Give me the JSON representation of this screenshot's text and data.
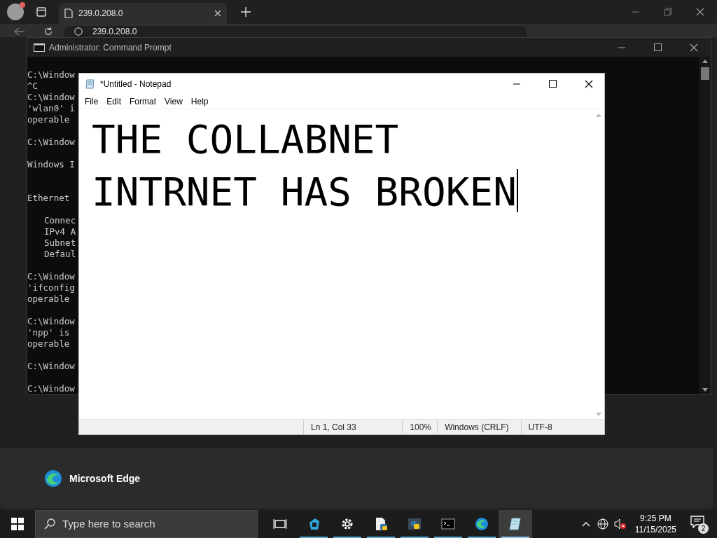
{
  "browser": {
    "tab_title": "239.0.208.0",
    "address": "239.0.208.0"
  },
  "cmd": {
    "title": "Administrator: Command Prompt",
    "lines": [
      {
        "kind": "line",
        "text": "C:\\Window"
      },
      {
        "kind": "line",
        "text": "^C"
      },
      {
        "kind": "line",
        "text": "C:\\Window"
      },
      {
        "kind": "line",
        "text": "'wlan0' i"
      },
      {
        "kind": "line",
        "text": "operable"
      },
      {
        "kind": "blank"
      },
      {
        "kind": "line",
        "text": "C:\\Window"
      },
      {
        "kind": "blank"
      },
      {
        "kind": "line",
        "text": "Windows I"
      },
      {
        "kind": "blank"
      },
      {
        "kind": "blank"
      },
      {
        "kind": "line",
        "text": "Ethernet"
      },
      {
        "kind": "blank"
      },
      {
        "kind": "indented",
        "text": "Connec"
      },
      {
        "kind": "indented",
        "text": "IPv4 A"
      },
      {
        "kind": "indented",
        "text": "Subnet"
      },
      {
        "kind": "indented",
        "text": "Defaul"
      },
      {
        "kind": "blank"
      },
      {
        "kind": "line",
        "text": "C:\\Window"
      },
      {
        "kind": "line",
        "text": "'ifconfig"
      },
      {
        "kind": "line",
        "text": "operable"
      },
      {
        "kind": "blank"
      },
      {
        "kind": "line",
        "text": "C:\\Window"
      },
      {
        "kind": "line",
        "text": "'npp' is"
      },
      {
        "kind": "line",
        "text": "operable"
      },
      {
        "kind": "blank"
      },
      {
        "kind": "line",
        "text": "C:\\Window"
      },
      {
        "kind": "blank"
      },
      {
        "kind": "line",
        "text": "C:\\Window"
      }
    ]
  },
  "notepad": {
    "title": "*Untitled - Notepad",
    "menu": [
      "File",
      "Edit",
      "Format",
      "View",
      "Help"
    ],
    "text": "THE COLLABNET INTRNET HAS BROKEN",
    "status_bar": [
      "Ln 1, Col 33",
      "100%",
      "Windows (CRLF)",
      "UTF-8"
    ]
  },
  "flyout": {
    "label": "Microsoft Edge"
  },
  "taskbar": {
    "search_placeholder": "Type here to search",
    "apps": [
      {
        "kind": "taskview",
        "running": false,
        "selected": false
      },
      {
        "kind": "blueapp",
        "running": true,
        "selected": false
      },
      {
        "kind": "settings",
        "running": true,
        "selected": false
      },
      {
        "kind": "pyfile",
        "running": true,
        "selected": false
      },
      {
        "kind": "python",
        "running": true,
        "selected": false
      },
      {
        "kind": "cmd",
        "running": true,
        "selected": false
      },
      {
        "kind": "edge",
        "running": true,
        "selected": false
      },
      {
        "kind": "notepad",
        "running": true,
        "selected": true
      }
    ],
    "time": "9:25 PM",
    "date": "11/15/2025",
    "notifications": "2"
  }
}
